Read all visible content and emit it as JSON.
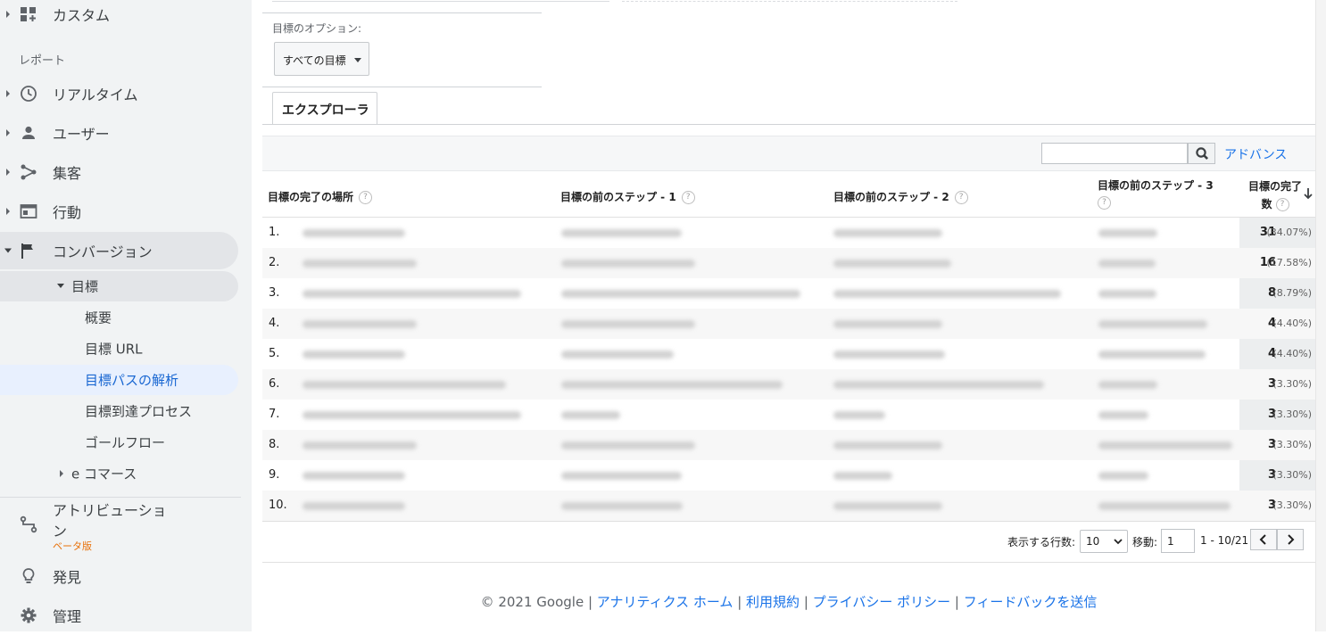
{
  "sidebar": {
    "items_top": [
      {
        "label": "カスタム"
      }
    ],
    "section_label": "レポート",
    "items": [
      {
        "label": "リアルタイム"
      },
      {
        "label": "ユーザー"
      },
      {
        "label": "集客"
      },
      {
        "label": "行動"
      },
      {
        "label": "コンバージョン"
      }
    ],
    "goals": {
      "label": "目標",
      "sub": [
        {
          "label": "概要"
        },
        {
          "label": "目標 URL"
        },
        {
          "label": "目標パスの解析"
        },
        {
          "label": "目標到達プロセス"
        },
        {
          "label": "ゴールフロー"
        }
      ]
    },
    "ecommerce": {
      "label": "e コマース"
    },
    "bottom": [
      {
        "label": "アトリビューション",
        "badge": "ベータ版"
      },
      {
        "label": "発見"
      },
      {
        "label": "管理"
      }
    ]
  },
  "options": {
    "label": "目標のオプション:",
    "select_value": "すべての目標"
  },
  "tabs": [
    {
      "label": "エクスプローラ"
    }
  ],
  "toolbar": {
    "advanced_label": "アドバンス"
  },
  "table": {
    "headers": [
      "目標の完了の場所",
      "目標の前のステップ - 1",
      "目標の前のステップ - 2",
      "目標の前のステップ - 3",
      "目標の完了数"
    ],
    "help_glyph": "?",
    "rows": [
      {
        "idx": "1.",
        "count": "31",
        "pct": "(34.07%)"
      },
      {
        "idx": "2.",
        "count": "16",
        "pct": "(17.58%)"
      },
      {
        "idx": "3.",
        "count": "8",
        "pct": "(8.79%)"
      },
      {
        "idx": "4.",
        "count": "4",
        "pct": "(4.40%)"
      },
      {
        "idx": "5.",
        "count": "4",
        "pct": "(4.40%)"
      },
      {
        "idx": "6.",
        "count": "3",
        "pct": "(3.30%)"
      },
      {
        "idx": "7.",
        "count": "3",
        "pct": "(3.30%)"
      },
      {
        "idx": "8.",
        "count": "3",
        "pct": "(3.30%)"
      },
      {
        "idx": "9.",
        "count": "3",
        "pct": "(3.30%)"
      },
      {
        "idx": "10.",
        "count": "3",
        "pct": "(3.30%)"
      }
    ]
  },
  "pagination": {
    "rows_label": "表示する行数:",
    "rows_value": "10",
    "goto_label": "移動:",
    "goto_value": "1",
    "range": "1 - 10/21"
  },
  "footer": {
    "copyright": "© 2021 Google",
    "links": [
      "アナリティクス ホーム",
      "利用規約",
      "プライバシー ポリシー",
      "フィードバックを送信"
    ]
  },
  "colors": {
    "accent": "#1a73e8",
    "active_bg": "#e8f0fe",
    "beta": "#e8710a"
  }
}
